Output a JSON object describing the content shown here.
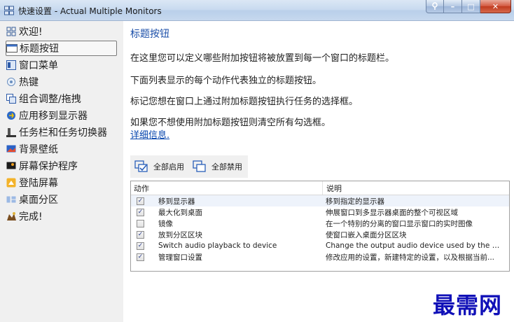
{
  "window": {
    "title": "快速设置 - Actual Multiple Monitors",
    "buttons": {
      "pin": "pin-icon",
      "minimize": "–",
      "maximize": "□",
      "close": "✕"
    }
  },
  "sidebar": {
    "items": [
      {
        "label": "欢迎!",
        "icon": "welcome-icon",
        "active": false
      },
      {
        "label": "标题按钮",
        "icon": "title-buttons-icon",
        "active": true
      },
      {
        "label": "窗口菜单",
        "icon": "window-menu-icon",
        "active": false
      },
      {
        "label": "热键",
        "icon": "hotkey-icon",
        "active": false
      },
      {
        "label": "组合调整/拖拽",
        "icon": "combo-drag-icon",
        "active": false
      },
      {
        "label": "应用移到显示器",
        "icon": "move-to-monitor-icon",
        "active": false
      },
      {
        "label": "任务栏和任务切换器",
        "icon": "taskbar-icon",
        "active": false
      },
      {
        "label": "背景壁纸",
        "icon": "wallpaper-icon",
        "active": false
      },
      {
        "label": "屏幕保护程序",
        "icon": "screensaver-icon",
        "active": false
      },
      {
        "label": "登陆屏幕",
        "icon": "login-screen-icon",
        "active": false
      },
      {
        "label": "桌面分区",
        "icon": "desktop-divider-icon",
        "active": false
      },
      {
        "label": "完成!",
        "icon": "finish-icon",
        "active": false
      }
    ]
  },
  "main": {
    "title": "标题按钮",
    "paragraphs": [
      "在这里您可以定义哪些附加按钮将被放置到每一个窗口的标题栏。",
      "下面列表显示的每个动作代表独立的标题按钮。",
      "标记您想在窗口上通过附加标题按钮执行任务的选择框。",
      "如果您不想使用附加标题按钮则清空所有勾选框。"
    ],
    "link": "详细信息.",
    "toolbar": {
      "enable_all": "全部启用",
      "disable_all": "全部禁用"
    },
    "list": {
      "headers": {
        "action": "动作",
        "description": "说明"
      },
      "rows": [
        {
          "checked": true,
          "action": "移到显示器",
          "description": "移到指定的显示器"
        },
        {
          "checked": true,
          "action": "最大化到桌面",
          "description": "伸展窗口到多显示器桌面的整个可视区域"
        },
        {
          "checked": false,
          "action": "镜像",
          "description": "在一个特别的分离的窗口显示窗口的实时图像"
        },
        {
          "checked": true,
          "action": "放到分区区块",
          "description": "使窗口嵌入桌面分区区块"
        },
        {
          "checked": true,
          "action": "Switch audio playback to device",
          "description": "Change the output audio device used by the application"
        },
        {
          "checked": true,
          "action": "管理窗口设置",
          "description": "修改应用的设置，新建特定的设置，以及根据当前..."
        }
      ]
    }
  },
  "watermark": "最需网"
}
